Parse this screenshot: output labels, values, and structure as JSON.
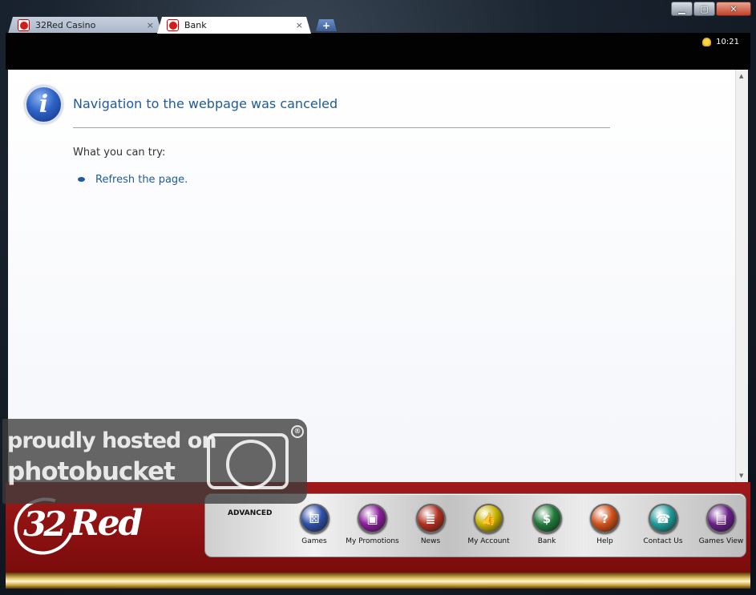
{
  "browser": {
    "tabs": [
      {
        "title": "32Red Casino",
        "close": "×",
        "active": false
      },
      {
        "title": "Bank",
        "close": "×",
        "active": true
      }
    ],
    "new_tab": "+",
    "window_controls": {
      "minimize": "▁",
      "maximize": "▢",
      "close": "✕"
    },
    "clock": "10:21"
  },
  "page": {
    "title": "Navigation to the webpage was canceled",
    "try_label": "What you can try:",
    "suggestions": [
      "Refresh the page."
    ]
  },
  "watermark": {
    "line1": "proudly hosted on",
    "line2": "photobucket",
    "reg": "®"
  },
  "casino": {
    "logo": {
      "num": "32",
      "word": "Red"
    },
    "mode_label": "ADVANCED",
    "nav": [
      {
        "label": "Games",
        "icon": "dice-icon",
        "glyph": "⚄",
        "color": "#2e4fa8"
      },
      {
        "label": "My Promotions",
        "icon": "gift-icon",
        "glyph": "▣",
        "color": "#8a1e9a"
      },
      {
        "label": "News",
        "icon": "newspaper-icon",
        "glyph": "≣",
        "color": "#b03020"
      },
      {
        "label": "My Account",
        "icon": "thumbs-up-icon",
        "glyph": "👍",
        "color": "#c9b400"
      },
      {
        "label": "Bank",
        "icon": "dollar-icon",
        "glyph": "$",
        "color": "#1f7a3a"
      },
      {
        "label": "Help",
        "icon": "question-icon",
        "glyph": "?",
        "color": "#d0501a"
      },
      {
        "label": "Contact Us",
        "icon": "phone-icon",
        "glyph": "☎",
        "color": "#1f9a9a"
      },
      {
        "label": "Games View",
        "icon": "games-view-icon",
        "glyph": "▤",
        "color": "#6a1f8a"
      }
    ]
  }
}
